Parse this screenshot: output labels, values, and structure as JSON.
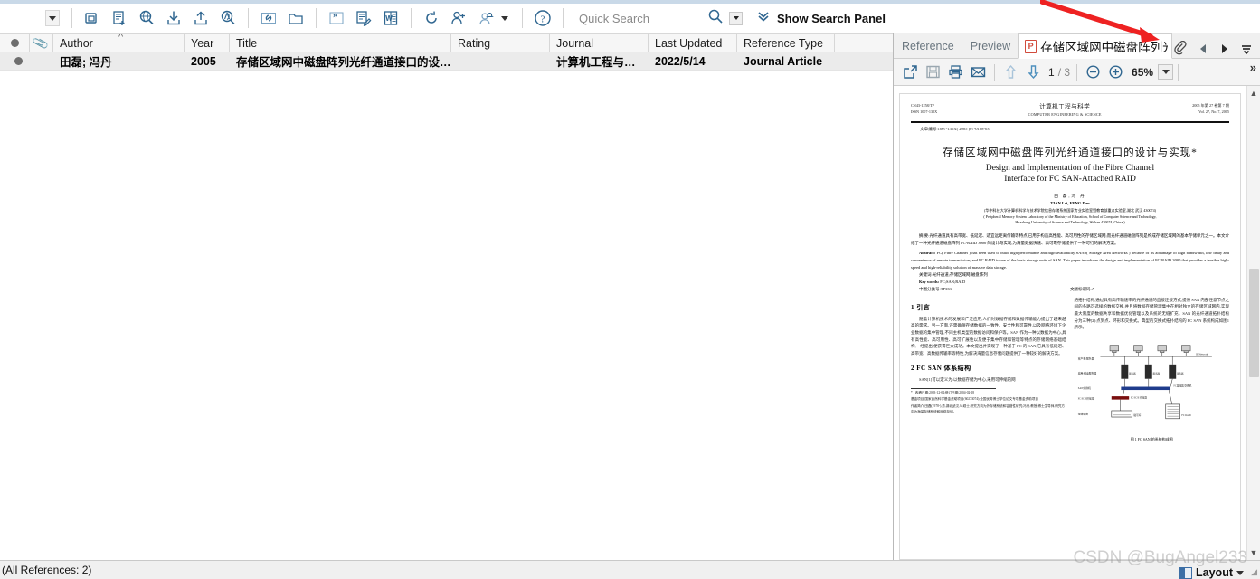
{
  "toolbar": {
    "dropdown_caret": "▾",
    "icons": [
      {
        "name": "copy-reference-icon",
        "label": "Copy Reference"
      },
      {
        "name": "new-reference-icon",
        "label": "New Reference"
      },
      {
        "name": "online-search-icon",
        "label": "Online Search"
      },
      {
        "name": "import-icon",
        "label": "Import"
      },
      {
        "name": "export-icon",
        "label": "Export"
      },
      {
        "name": "find-full-text-icon",
        "label": "Find Full Text"
      },
      {
        "name": "link-icon",
        "label": "Open Link"
      },
      {
        "name": "open-file-icon",
        "label": "Open File"
      },
      {
        "name": "insert-citation-icon",
        "label": "Insert Citation"
      },
      {
        "name": "format-bibliography-icon",
        "label": "Format Bibliography"
      },
      {
        "name": "export-word-icon",
        "label": "Export to Word"
      },
      {
        "name": "sync-icon",
        "label": "Sync"
      },
      {
        "name": "share-icon",
        "label": "Share"
      },
      {
        "name": "notify-icon",
        "label": "Activity Feed"
      },
      {
        "name": "help-icon",
        "label": "Help"
      }
    ],
    "quick_search_placeholder": "Quick Search",
    "search_icon": "search-icon",
    "show_search_panel_label": "Show Search Panel",
    "chevrons_down_icon": "chevrons-down-icon"
  },
  "library": {
    "columns": [
      {
        "key": "dot",
        "label": ""
      },
      {
        "key": "attachment",
        "label": ""
      },
      {
        "key": "author",
        "label": "Author"
      },
      {
        "key": "year",
        "label": "Year"
      },
      {
        "key": "title",
        "label": "Title"
      },
      {
        "key": "rating",
        "label": "Rating"
      },
      {
        "key": "journal",
        "label": "Journal"
      },
      {
        "key": "last_updated",
        "label": "Last Updated"
      },
      {
        "key": "reference_type",
        "label": "Reference Type"
      }
    ],
    "sort_indicator": "^",
    "rows": [
      {
        "dot": "●",
        "attachment": "",
        "author": "田磊; 冯丹",
        "year": "2005",
        "title": "存储区域网中磁盘阵列光纤通道接口的设…",
        "rating": "",
        "journal": "计算机工程与…",
        "last_updated": "2022/5/14",
        "reference_type": "Journal Article"
      }
    ]
  },
  "right_panel": {
    "tabs": [
      {
        "label": "Reference",
        "active": false
      },
      {
        "label": "Preview",
        "active": false
      }
    ],
    "doc_tab": {
      "pdf_badge": "P",
      "title": "存储区域网中磁盘阵列光纤通…",
      "attachment_icon": "paperclip-icon",
      "prev_icon": "triangle-left-icon",
      "next_icon": "triangle-right-icon",
      "menu_icon": "tab-list-icon"
    },
    "pdf_toolbar": {
      "open_external_icon": "open-external-icon",
      "save_icon": "save-icon",
      "print_icon": "print-icon",
      "email_icon": "email-icon",
      "prev_page_icon": "arrow-up-icon",
      "next_page_icon": "arrow-down-icon",
      "current_page": "1",
      "total_pages": "/ 3",
      "zoom_out_icon": "zoom-out-icon",
      "zoom_in_icon": "zoom-in-icon",
      "zoom_level": "65%",
      "zoom_caret": "▾",
      "overflow_label": "»"
    },
    "scrollbar": {
      "up": "▲",
      "down": "▼"
    }
  },
  "pdf": {
    "journal_left_1": "CN43-1258/TP",
    "journal_left_2": "ISSN 1007-130X",
    "journal_mid_cn": "计算机工程与科学",
    "journal_mid_en": "COMPUTER ENGINEERING & SCIENCE",
    "journal_right_1": "2005 年第 27 卷第 7 期",
    "journal_right_2": "Vol. 27, No. 7, 2005",
    "article_no": "文章编号:1007-130X( 2005 )07-0108-03",
    "title_cn": "存储区域网中磁盘阵列光纤通道接口的设计与实现*",
    "title_en_1": "Design and Implementation of the Fibre Channel",
    "title_en_2": "Interface for FC SAN-Attached RAID",
    "authors_cn": "田 磊,冯 丹",
    "authors_en": "TIAN Lei, FENG Dan",
    "affil_cn": "(华中科技大学计算机科学与技术学院信息存储系统国家专业实验室暨教育部重点实验室,湖北 武汉 430074)",
    "affil_en_1": "( Peripheral Memory System Laboratory of the Ministry of Education, School of Computer Science and Technology,",
    "affil_en_2": "Huazhong University of Science and Technology, Wuhan 430074, China )",
    "abstract_cn": "摘 要:光纤通道具有高带宽、低延迟、适宜远距离传输等特点,已用于构造高性能、高可用性的存储区域网;而光纤通道磁盘阵列是构成存储区域网的基本存储单元之一。本文介绍了一种光纤通道磁盘阵列 FC-RAID 3000 的设计与实现,为海量数据快速、高可靠存储提供了一种可行的解决方案。",
    "abstract_en_label": "Abstract:",
    "abstract_en": "FC( Fibre Channel ) has been used to build high-performance and high-availability SANS( Storage Area Networks ) because of its advantage of high bandwidth, low delay and convenience of remote transmission; and FC RAID is one of the basic storage units of SAN. This paper introduces the design and implementation of FC-RAID 3000 that provides a feasible high-speed and high-reliability solution of massive data storage.",
    "keywords_cn": "关键词:光纤通道;存储区域网;磁盘阵列",
    "keywords_en_label": "Key words:",
    "keywords_en": "FC;SAN;RAID",
    "clc_label": "中图分类号:TP333",
    "doc_code": "文献标识码:A",
    "section1_heading": "1   引言",
    "section1_para": "随着计算机技术的发展和广泛应用,人们对数据存储和数据传输能力提出了越来越高的需求。另一方面,还需确保存储数据的一致性、安全性和可靠性,以及网络环境下企业数据的集中管理,不同主机类型的数据访问和保护等。SAN 作为一种以数据为中心,具有高性能、高可用性、高可扩展性以及便于集中存储和管理等特点的存储网络基础结构,一经提出,便获得巨大成功。本文提出并实现了一种基于 FC 的 SAN,它具有低延迟、高带宽、高数据传输率等特性,为解决海量信息存储问题提供了一种较好的解决方案。",
    "section2_heading": "2   FC SAN 体系结构",
    "section2_para": "SAN[1]可以定义为:以数据存储为中心,采用可伸缩的网",
    "right_col_para": "络拓扑结构,通过具有高传输速率的光纤通道的直接连接方式,提供 SAN 内部任意节点之间的多路可选择的数据交换,并且将数据存储管理集中在相对独立的存储区域网内,实现最大限度的数据共享和数据优化管理以及系统的无缝扩充。SAN 的光纤通道拓扑结构分为三种[2]:点到点、环形和交换式。典型的交换式拓扑结构的 FC SAN 系统构成如图1所示。",
    "figure_caption": "图 1   FC SAN 的系统构成图",
    "figure_labels": {
      "l1": "客户机/服务器",
      "l2": "应用/磁盘服务器",
      "l3": "SAN 交换机",
      "l4": "FC/SCSI 桥接器",
      "l5": "存储设备",
      "r1": "IP Network",
      "r2": "FC 集线器/交换机",
      "r3": "FC/SCSI 桥接器",
      "r4": "磁带库",
      "r5": "FC RAID"
    },
    "footnote_1": "收稿日期:2003-12-04;修订日期:2004-02-18",
    "footnote_2": "基金项目:国家自然科学基金资助项目(60273074);全国优秀博士学位论文专项基金资助项目",
    "footnote_3": "作者简介:田磊(1978-),男,湖北武汉人,硕士,研究方向为外存储系统和容错性研究;冯丹,教授,博士生导师,研究方向为海量存储系统和网络存储。"
  },
  "status_bar": {
    "references_count_label": "(All References: 2)",
    "layout_label": "Layout",
    "layout_caret": "▾",
    "layout_icon": "layout-panel-icon"
  },
  "watermark": "CSDN @BugAngel233",
  "annotation": {
    "arrow_color": "#ee2222",
    "name": "red-arrow-annotation"
  }
}
